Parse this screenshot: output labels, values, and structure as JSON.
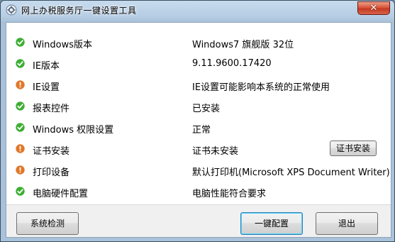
{
  "window": {
    "title": "网上办税服务厅一键设置工具",
    "close_label": "✕"
  },
  "colors": {
    "ok": "#3fae34",
    "warn": "#e0782a"
  },
  "rows": [
    {
      "label": "Windows版本",
      "value": "Windows7 旗舰版 32位",
      "status": "ok"
    },
    {
      "label": "IE版本",
      "value": "9.11.9600.17420",
      "status": "ok"
    },
    {
      "label": "IE设置",
      "value": "IE设置可能影响本系统的正常使用",
      "status": "warn"
    },
    {
      "label": "报表控件",
      "value": "已安装",
      "status": "ok"
    },
    {
      "label": "Windows 权限设置",
      "value": "正常",
      "status": "ok"
    },
    {
      "label": "证书安装",
      "value": "证书未安装",
      "status": "warn",
      "button": "证书安装"
    },
    {
      "label": "打印设备",
      "value": "默认打印机(Microsoft XPS Document Writer)",
      "status": "warn"
    },
    {
      "label": "电脑硬件配置",
      "value": "电脑性能符合要求",
      "status": "ok"
    }
  ],
  "footer": {
    "check_label": "系统检测",
    "config_label": "一键配置",
    "exit_label": "退出"
  }
}
